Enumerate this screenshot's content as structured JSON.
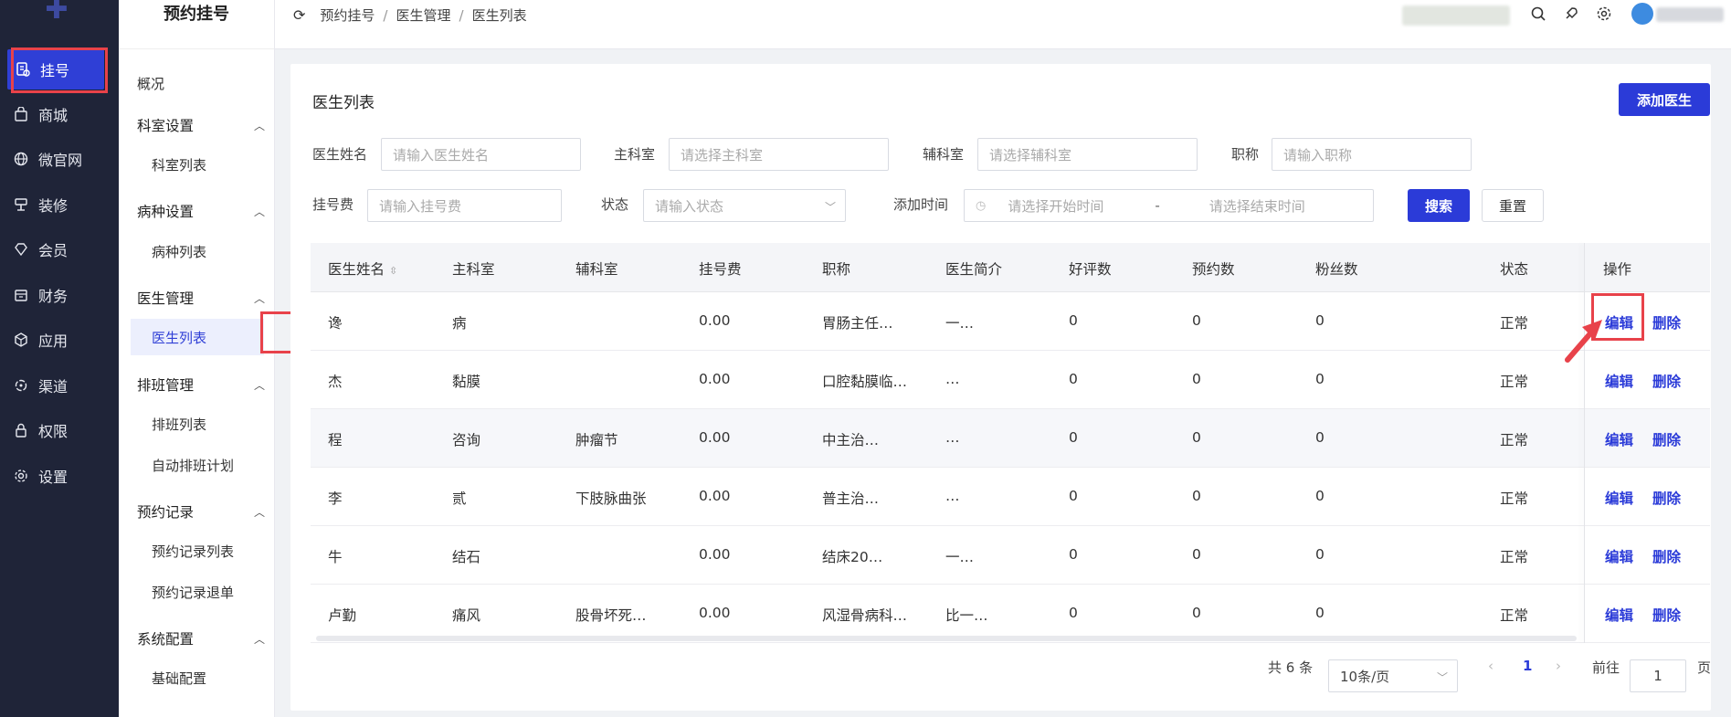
{
  "nav": {
    "items": [
      {
        "label": "挂号",
        "icon": "registration-icon",
        "active": true
      },
      {
        "label": "商城",
        "icon": "bag-icon"
      },
      {
        "label": "微官网",
        "icon": "globe-icon"
      },
      {
        "label": "装修",
        "icon": "decor-icon"
      },
      {
        "label": "会员",
        "icon": "diamond-icon"
      },
      {
        "label": "财务",
        "icon": "finance-icon"
      },
      {
        "label": "应用",
        "icon": "cube-icon"
      },
      {
        "label": "渠道",
        "icon": "channel-icon"
      },
      {
        "label": "权限",
        "icon": "lock-icon"
      },
      {
        "label": "设置",
        "icon": "gear-icon"
      }
    ]
  },
  "sidebar": {
    "title": "预约挂号",
    "overview": "概况",
    "groups": [
      {
        "label": "科室设置",
        "children": [
          "科室列表"
        ]
      },
      {
        "label": "病种设置",
        "children": [
          "病种列表"
        ]
      },
      {
        "label": "医生管理",
        "children": [
          "医生列表"
        ]
      },
      {
        "label": "排班管理",
        "children": [
          "排班列表",
          "自动排班计划"
        ]
      },
      {
        "label": "预约记录",
        "children": [
          "预约记录列表",
          "预约记录退单"
        ]
      },
      {
        "label": "系统配置",
        "children": [
          "基础配置"
        ]
      }
    ]
  },
  "breadcrumb": [
    "预约挂号",
    "医生管理",
    "医生列表"
  ],
  "page": {
    "title": "医生列表",
    "add_button": "添加医生",
    "filters": {
      "name_label": "医生姓名",
      "name_placeholder": "请输入医生姓名",
      "main_dept_label": "主科室",
      "main_dept_placeholder": "请选择主科室",
      "sub_dept_label": "辅科室",
      "sub_dept_placeholder": "请选择辅科室",
      "title_label": "职称",
      "title_placeholder": "请输入职称",
      "fee_label": "挂号费",
      "fee_placeholder": "请输入挂号费",
      "status_label": "状态",
      "status_placeholder": "请输入状态",
      "time_label": "添加时间",
      "start_placeholder": "请选择开始时间",
      "time_sep": "-",
      "end_placeholder": "请选择结束时间",
      "search_button": "搜索",
      "reset_button": "重置"
    },
    "columns": [
      "医生姓名",
      "主科室",
      "辅科室",
      "挂号费",
      "职称",
      "医生简介",
      "好评数",
      "预约数",
      "粉丝数",
      "状态",
      "操作"
    ],
    "rows": [
      {
        "name": "谗",
        "main": "病",
        "sub": "",
        "fee": "0.00",
        "title": "胃肠主任…",
        "intro": "一…",
        "good": "0",
        "appt": "0",
        "fans": "0",
        "status": "正常"
      },
      {
        "name": "杰",
        "main": "黏膜",
        "sub": "",
        "fee": "0.00",
        "title": "口腔黏膜临…",
        "intro": "…",
        "good": "0",
        "appt": "0",
        "fans": "0",
        "status": "正常"
      },
      {
        "name": "程",
        "main": "咨询",
        "sub": "肿瘤节",
        "fee": "0.00",
        "title": "中主治…",
        "intro": "…",
        "good": "0",
        "appt": "0",
        "fans": "0",
        "status": "正常"
      },
      {
        "name": "李",
        "main": "贰",
        "sub": "下肢脉曲张",
        "fee": "0.00",
        "title": "普主治…",
        "intro": "…",
        "good": "0",
        "appt": "0",
        "fans": "0",
        "status": "正常"
      },
      {
        "name": "牛",
        "main": "结石",
        "sub": "",
        "fee": "0.00",
        "title": "结床20…",
        "intro": "一…",
        "good": "0",
        "appt": "0",
        "fans": "0",
        "status": "正常"
      },
      {
        "name": "卢勤",
        "main": "痛风",
        "sub": "股骨坏死…",
        "fee": "0.00",
        "title": "风湿骨病科…",
        "intro": "比一…",
        "good": "0",
        "appt": "0",
        "fans": "0",
        "status": "正常"
      }
    ],
    "edit_label": "编辑",
    "delete_label": "删除",
    "pagination": {
      "total": "共 6 条",
      "page_size": "10条/页",
      "current": "1",
      "goto_label": "前往",
      "goto_value": "1",
      "page_unit": "页"
    }
  },
  "colors": {
    "accent": "#2b3bd8",
    "nav_bg": "#1f2438",
    "highlight": "#e8424a"
  }
}
